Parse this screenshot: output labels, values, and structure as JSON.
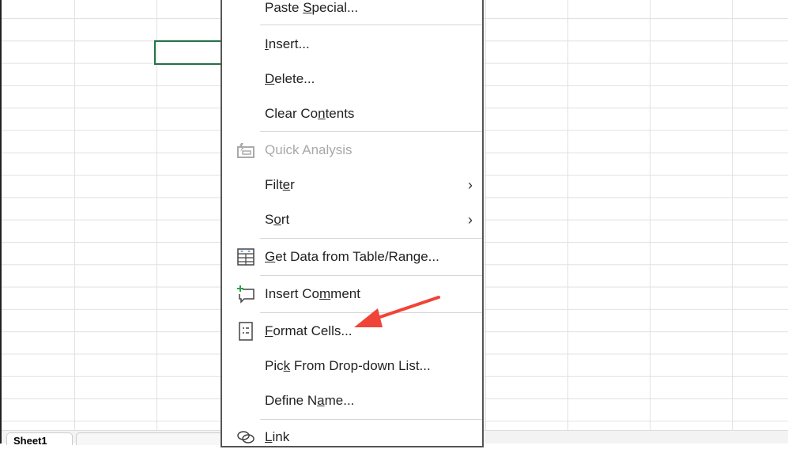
{
  "sheet_tabs": [
    {
      "label": "Sheet1"
    }
  ],
  "menu": {
    "items": [
      {
        "pre": "Paste ",
        "ul": "S",
        "post": "pecial...",
        "icon": null
      },
      {
        "pre": "",
        "ul": "I",
        "post": "nsert...",
        "icon": null
      },
      {
        "pre": "",
        "ul": "D",
        "post": "elete...",
        "icon": null
      },
      {
        "pre": "Clear Co",
        "ul": "n",
        "post": "tents",
        "icon": null
      },
      {
        "pre": "",
        "ul": "Q",
        "post": "uick Analysis",
        "icon": "quick-analysis-icon",
        "disabled": true
      },
      {
        "pre": "Filt",
        "ul": "e",
        "post": "r",
        "submenu": true
      },
      {
        "pre": "S",
        "ul": "o",
        "post": "rt",
        "submenu": true
      },
      {
        "pre": "",
        "ul": "G",
        "post": "et Data from Table/Range...",
        "icon": "table-icon"
      },
      {
        "pre": "Insert Co",
        "ul": "m",
        "post": "ment",
        "icon": "new-comment-icon"
      },
      {
        "pre": "",
        "ul": "F",
        "post": "ormat Cells...",
        "icon": "format-cells-icon"
      },
      {
        "pre": "Pic",
        "ul": "k",
        "post": " From Drop-down List..."
      },
      {
        "pre": "Define N",
        "ul": "a",
        "post": "me..."
      },
      {
        "pre": "",
        "ul": "L",
        "post": "ink",
        "icon": "link-icon"
      }
    ]
  },
  "colors": {
    "selection": "#217346",
    "arrow": "#f04438"
  }
}
